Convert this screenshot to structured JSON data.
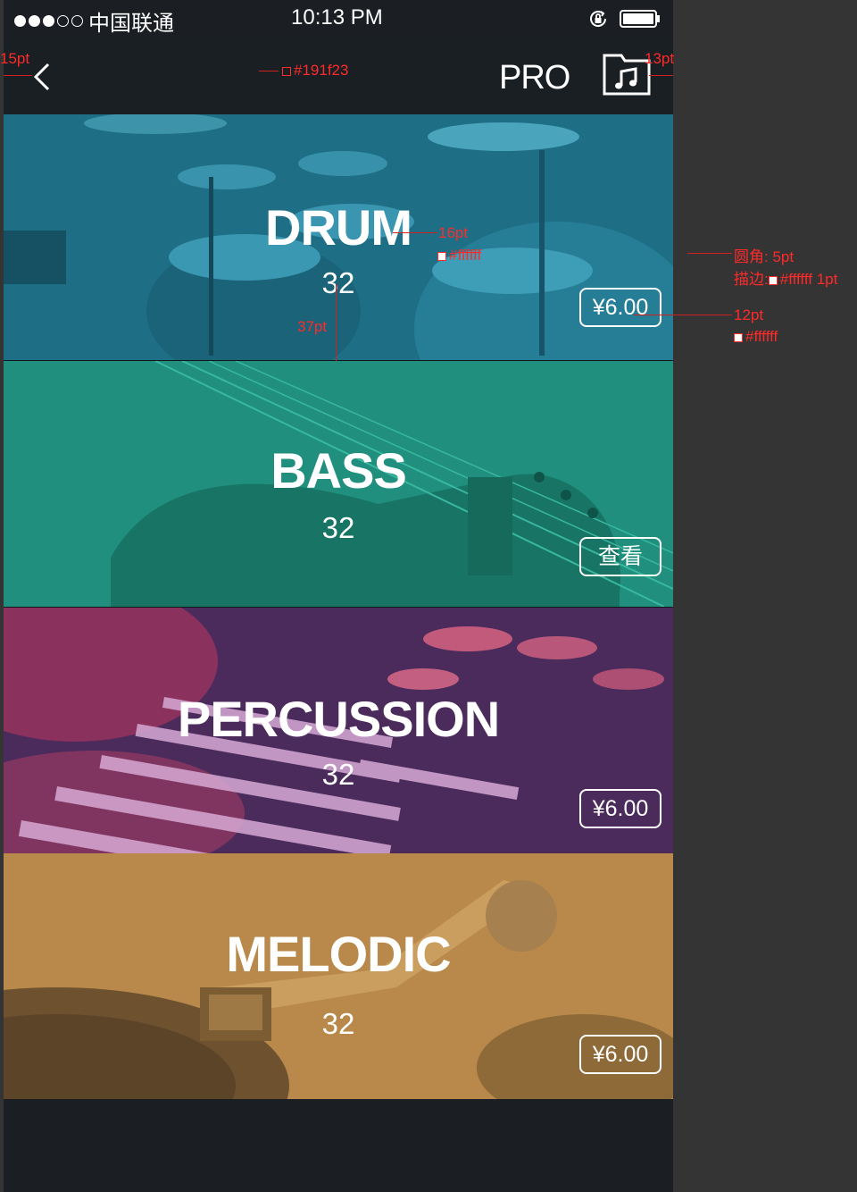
{
  "status_bar": {
    "carrier": "中国联通",
    "time": "10:13 PM",
    "signal_dots_filled": 3,
    "signal_dots_total": 5
  },
  "nav": {
    "title": "PRO",
    "back_icon": "chevron-left-icon",
    "right_icon": "music-folder-icon",
    "background": "#191f23"
  },
  "cards": [
    {
      "title": "DRUM",
      "count": "32",
      "action": "¥6.00",
      "tint": "#1e7d95"
    },
    {
      "title": "BASS",
      "count": "32",
      "action": "查看",
      "tint": "#20907e"
    },
    {
      "title": "PERCUSSION",
      "count": "32",
      "action": "¥6.00",
      "tint": "#4a2657"
    },
    {
      "title": "MELODIC",
      "count": "32",
      "action": "¥6.00",
      "tint": "#b58a4c"
    }
  ],
  "annotations": {
    "left_margin": "15pt",
    "nav_color": "#191f23",
    "right_margin": "13pt",
    "title_size": "16pt",
    "title_color": "#ffffff",
    "title_gap": "37pt",
    "corner_radius": "圆角: 5pt",
    "border_prefix": "描边:",
    "border_value": "#ffffff 1pt",
    "price_size": "12pt",
    "price_color": "#ffffff"
  }
}
